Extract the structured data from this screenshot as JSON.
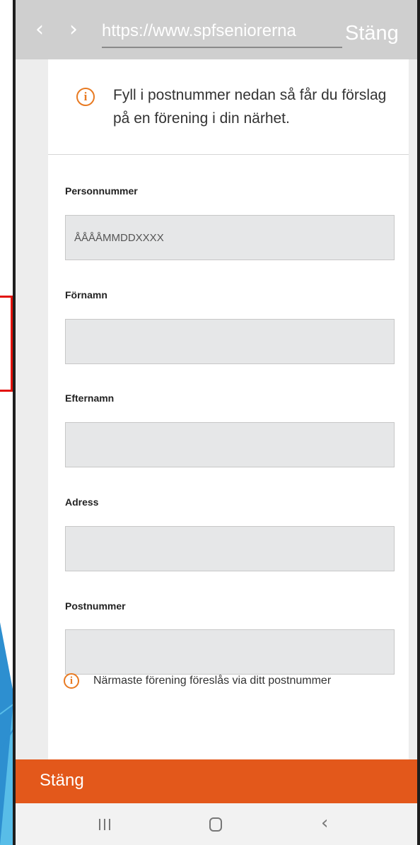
{
  "browser": {
    "back_glyph": "‹",
    "forward_glyph": "›",
    "url": "https://www.spfseniorerna",
    "close_label": "Stäng"
  },
  "info_banner": {
    "icon": "info-circle-icon",
    "text": "Fyll i postnummer nedan så får du förslag på en förening i din närhet."
  },
  "form": {
    "fields": [
      {
        "label": "Personnummer",
        "placeholder": "ÅÅÅÅMMDDXXXX",
        "value": ""
      },
      {
        "label": "Förnamn",
        "placeholder": "",
        "value": ""
      },
      {
        "label": "Efternamn",
        "placeholder": "",
        "value": ""
      },
      {
        "label": "Adress",
        "placeholder": "",
        "value": ""
      },
      {
        "label": "Postnummer",
        "placeholder": "",
        "value": ""
      }
    ],
    "hint": {
      "icon": "info-circle-icon",
      "text": "Närmaste förening föreslås via ditt postnummer"
    }
  },
  "close_bar": {
    "label": "Stäng"
  },
  "system_nav": {
    "icons": [
      "recents-icon",
      "home-icon",
      "back-icon"
    ],
    "back_glyph": "‹"
  },
  "colors": {
    "accent": "#e3581b",
    "info_icon": "#e87a22",
    "browser_bar": "#cfcfcf",
    "input_bg": "#e6e7e8",
    "marker": "#e3120b"
  }
}
